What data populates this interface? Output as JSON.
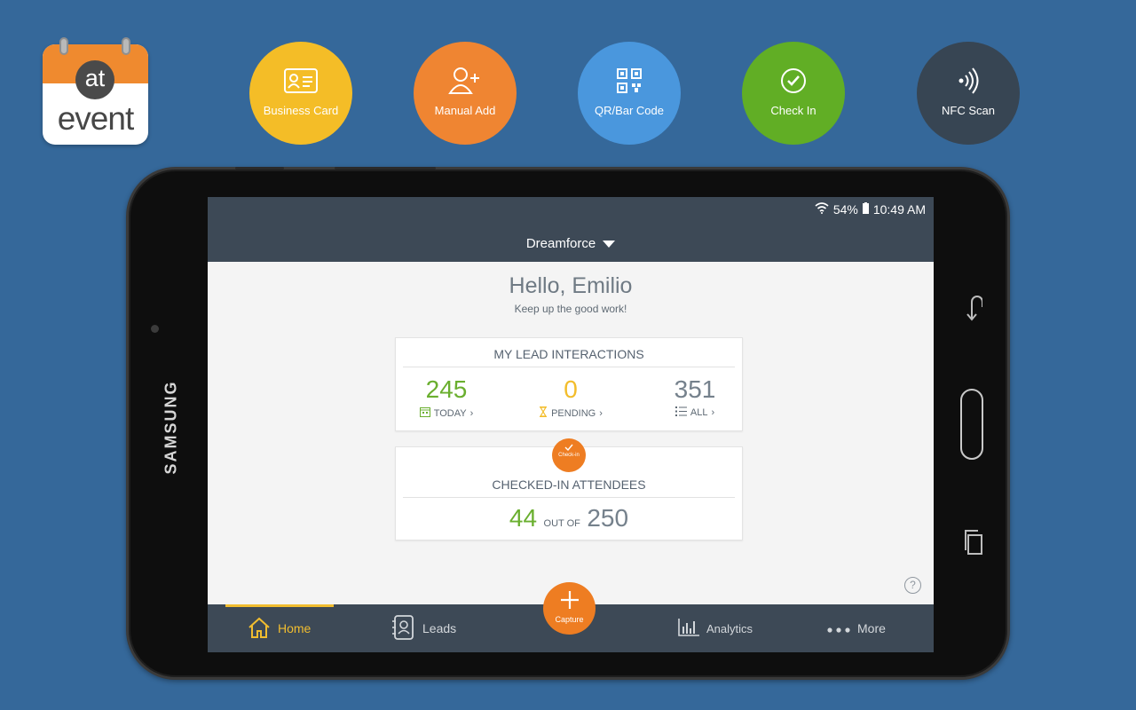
{
  "logo": {
    "at": "at",
    "event": "event"
  },
  "features": [
    {
      "label": "Business Card",
      "color": "#f4bd27",
      "icon": "business-card-icon"
    },
    {
      "label": "Manual Add",
      "color": "#ef8532",
      "icon": "add-person-icon"
    },
    {
      "label": "QR/Bar Code",
      "color": "#4a97dd",
      "icon": "qr-code-icon"
    },
    {
      "label": "Check In",
      "color": "#61ae25",
      "icon": "check-circle-icon"
    },
    {
      "label": "NFC Scan",
      "color": "#374553",
      "icon": "nfc-icon"
    }
  ],
  "device": {
    "brand": "SAMSUNG"
  },
  "status": {
    "battery": "54%",
    "time": "10:49 AM"
  },
  "header": {
    "event_name": "Dreamforce"
  },
  "greeting": {
    "title": "Hello, Emilio",
    "subtitle": "Keep up the good work!"
  },
  "lead_card": {
    "title": "MY LEAD INTERACTIONS",
    "today": {
      "value": "245",
      "label": "TODAY",
      "color": "#6aaf2f"
    },
    "pending": {
      "value": "0",
      "label": "PENDING",
      "color": "#f3bd2b"
    },
    "all": {
      "value": "351",
      "label": "ALL",
      "color": "#75818c"
    }
  },
  "checkin_card": {
    "badge_label": "Check-in",
    "title": "CHECKED-IN ATTENDEES",
    "checked": "44",
    "out_of": "OUT OF",
    "total": "250"
  },
  "nav": {
    "home": "Home",
    "leads": "Leads",
    "capture": "Capture",
    "analytics": "Analytics",
    "more": "More"
  },
  "colors": {
    "accent": "#ee7d22",
    "header": "#3d4956",
    "background": "#35689a",
    "active": "#f1bd2f"
  }
}
